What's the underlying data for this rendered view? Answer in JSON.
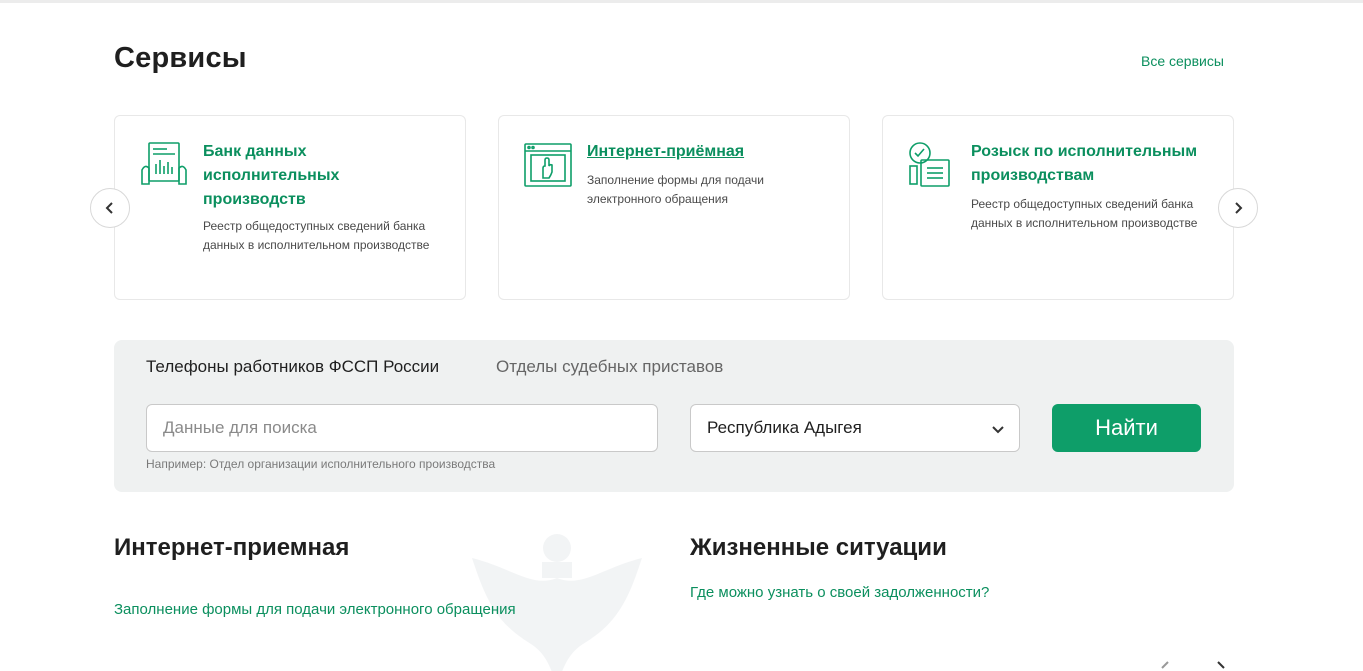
{
  "services": {
    "title": "Сервисы",
    "all_link": "Все сервисы",
    "cards": [
      {
        "title": "Банк данных исполнительных производств",
        "description": "Реестр общедоступных сведений банка данных в исполнительном производстве",
        "icon": "document-chart-icon"
      },
      {
        "title": "Интернет-приёмная",
        "description": "Заполнение формы для подачи электронного обращения",
        "icon": "browser-hand-icon"
      },
      {
        "title": "Розыск по исполнительным производствам",
        "description": "Реестр общедоступных сведений банка данных в исполнительном производстве",
        "icon": "search-checklist-icon"
      }
    ],
    "prev_icon": "chevron-left-icon",
    "next_icon": "chevron-right-icon"
  },
  "search": {
    "tabs": [
      "Телефоны работников ФССП России",
      "Отделы судебных приставов"
    ],
    "input_placeholder": "Данные для поиска",
    "hint": "Например: Отдел организации исполнительного производства",
    "region": "Республика Адыгея",
    "button": "Найти"
  },
  "reception": {
    "title": "Интернет-приемная",
    "link": "Заполнение формы для подачи электронного обращения"
  },
  "situations": {
    "title": "Жизненные ситуации",
    "link": "Где можно узнать о своей задолженности?"
  },
  "colors": {
    "accent": "#0e9e69",
    "link": "#0b8f5e",
    "panel": "#eff1f1"
  }
}
